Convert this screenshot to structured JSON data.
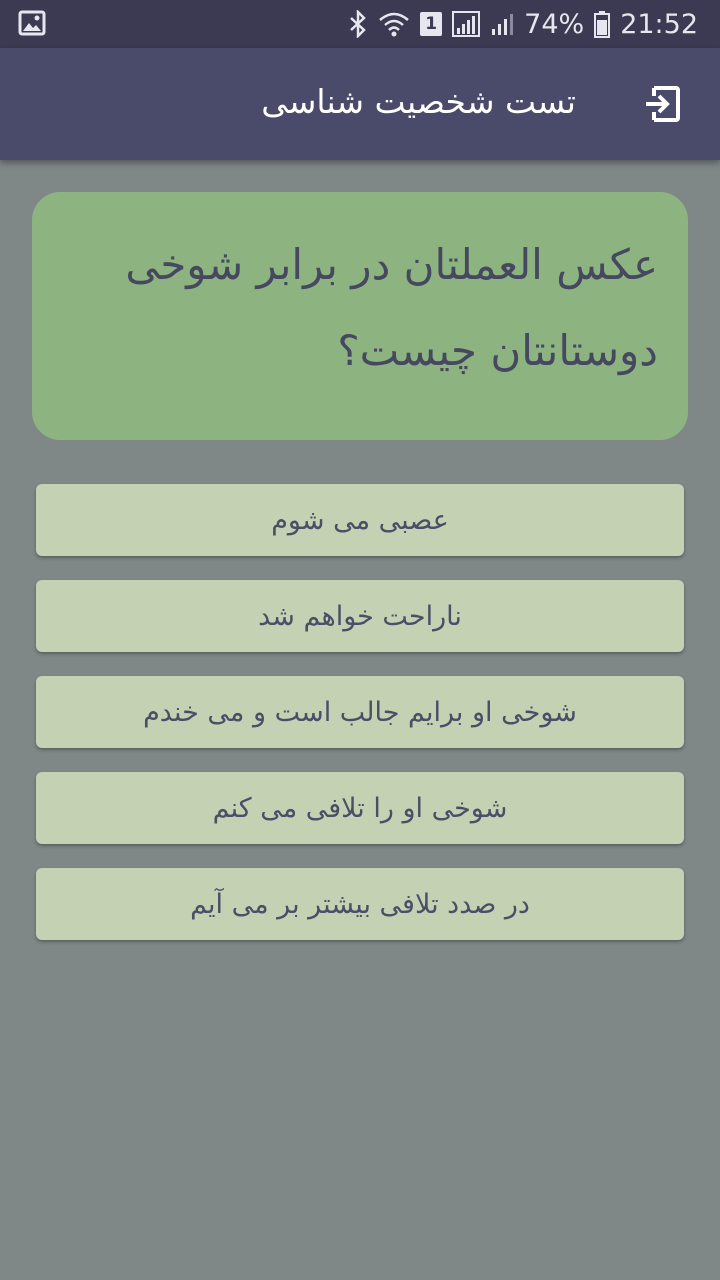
{
  "status_bar": {
    "battery_percent": "74%",
    "time": "21:52",
    "sim_slot": "1",
    "icons": [
      "gallery-icon",
      "bluetooth-icon",
      "wifi-icon",
      "sim-icon",
      "signal-icon",
      "signal-icon",
      "battery-icon"
    ]
  },
  "app_bar": {
    "title": "تست شخصیت شناسی",
    "exit_icon": "exit-icon"
  },
  "question": {
    "text": "عکس العملتان در برابر شوخی دوستانتان چیست؟"
  },
  "options": [
    {
      "label": "عصبی می شوم"
    },
    {
      "label": "ناراحت خواهم شد"
    },
    {
      "label": "شوخی او برایم جالب است و می خندم"
    },
    {
      "label": "شوخی او را تلافی می کنم"
    },
    {
      "label": "در صدد تلافی بیشتر بر می آیم"
    }
  ],
  "colors": {
    "status_bar": "#3b3a52",
    "app_bar": "#4a4a6a",
    "background": "#7f8886",
    "question_card": "#8db480",
    "option_button": "#c5d1b3",
    "text": "#45485f"
  }
}
